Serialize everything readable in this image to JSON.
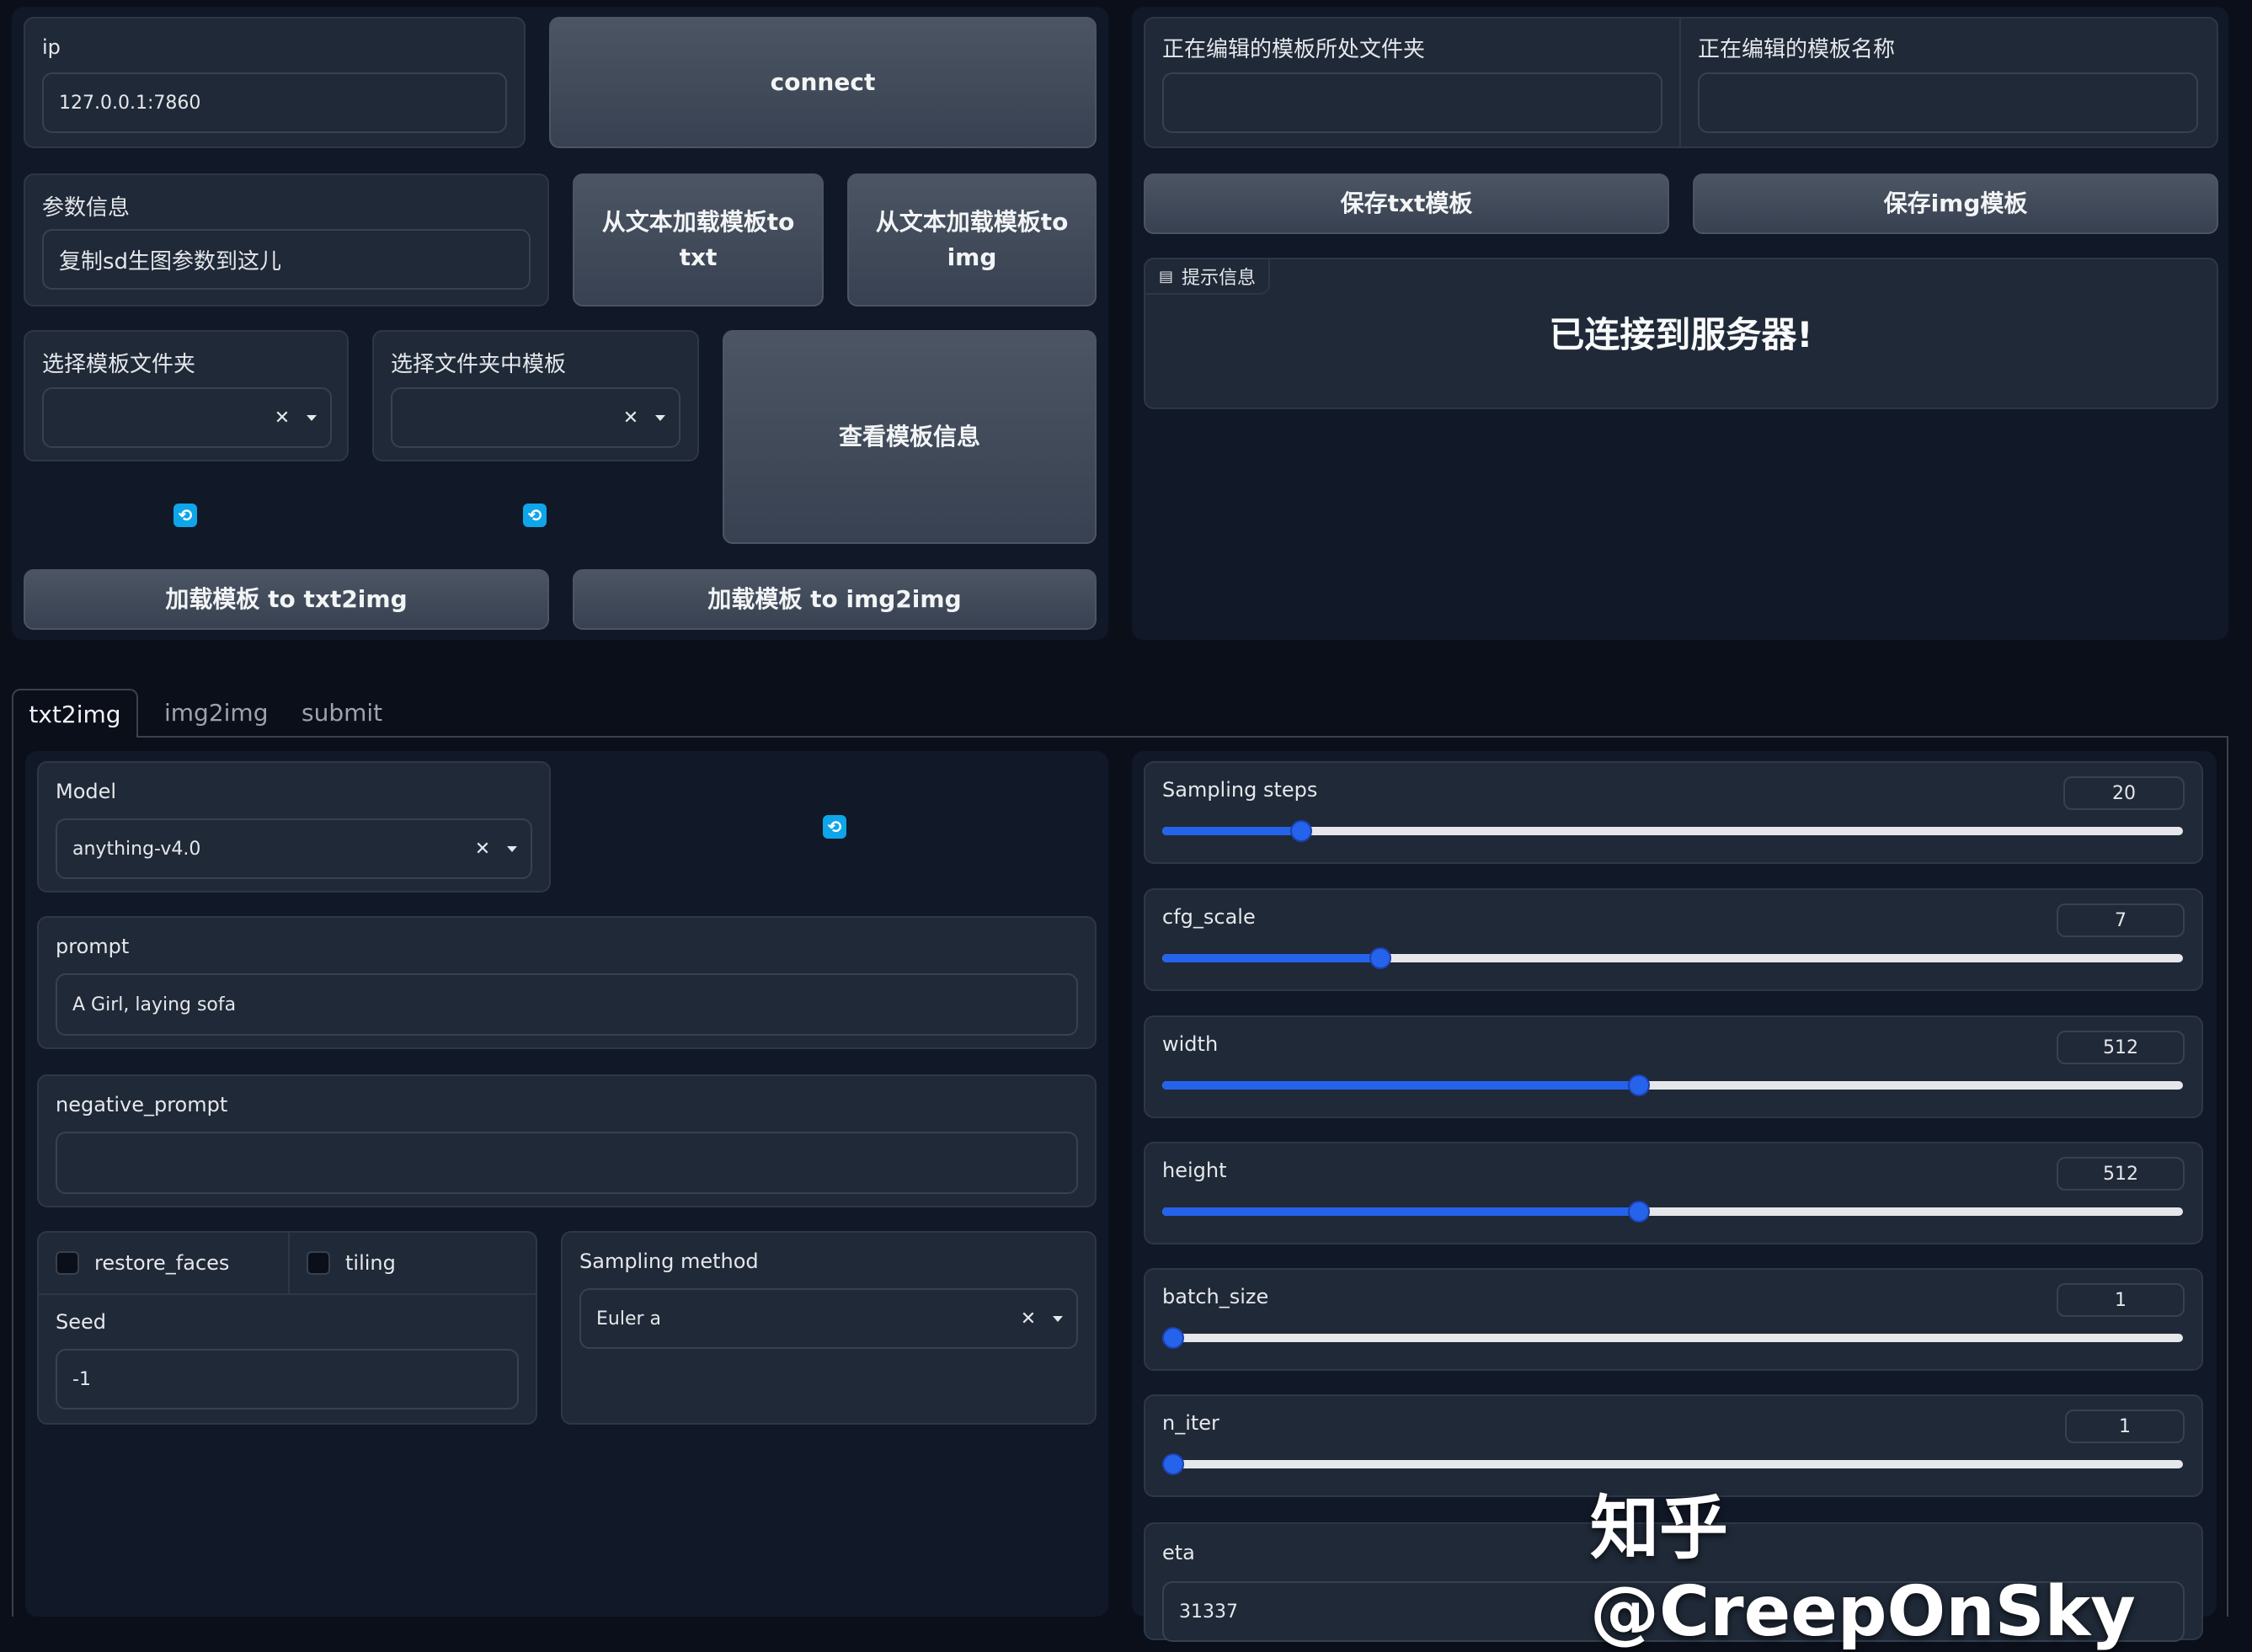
{
  "top_left": {
    "ip_label": "ip",
    "ip_value": "127.0.0.1:7860",
    "connect_label": "connect",
    "params_label": "参数信息",
    "params_value": "复制sd生图参数到这儿",
    "load_txt_label": "从文本加载模板to txt",
    "load_img_label": "从文本加载模板to img",
    "select_folder_label": "选择模板文件夹",
    "select_template_label": "选择文件夹中模板",
    "view_template_label": "查看模板信息",
    "load_txt2img_label": "加载模板 to txt2img",
    "load_img2img_label": "加载模板 to img2img"
  },
  "top_right": {
    "folder_label": "正在编辑的模板所处文件夹",
    "name_label": "正在编辑的模板名称",
    "save_txt_label": "保存txt模板",
    "save_img_label": "保存img模板",
    "info_tag": "提示信息",
    "info_message": "已连接到服务器!"
  },
  "tabs": [
    {
      "label": "txt2img",
      "active": true
    },
    {
      "label": "img2img",
      "active": false
    },
    {
      "label": "submit",
      "active": false
    }
  ],
  "txt2img": {
    "model_label": "Model",
    "model_value": "anything-v4.0",
    "prompt_label": "prompt",
    "prompt_value": "A Girl, laying sofa",
    "negative_label": "negative_prompt",
    "negative_value": "",
    "restore_faces_label": "restore_faces",
    "tiling_label": "tiling",
    "seed_label": "Seed",
    "seed_value": "-1",
    "sampling_method_label": "Sampling method",
    "sampling_method_value": "Euler a"
  },
  "sliders": [
    {
      "label": "Sampling steps",
      "value": "20",
      "fraction": 0.136
    },
    {
      "label": "cfg_scale",
      "value": "7",
      "fraction": 0.214
    },
    {
      "label": "width",
      "value": "512",
      "fraction": 0.467
    },
    {
      "label": "height",
      "value": "512",
      "fraction": 0.467
    },
    {
      "label": "batch_size",
      "value": "1",
      "fraction": 0.0
    },
    {
      "label": "n_iter",
      "value": "1",
      "fraction": 0.0
    }
  ],
  "eta": {
    "label": "eta",
    "value": "31337"
  },
  "watermark": "知乎 @CreepOnSky"
}
